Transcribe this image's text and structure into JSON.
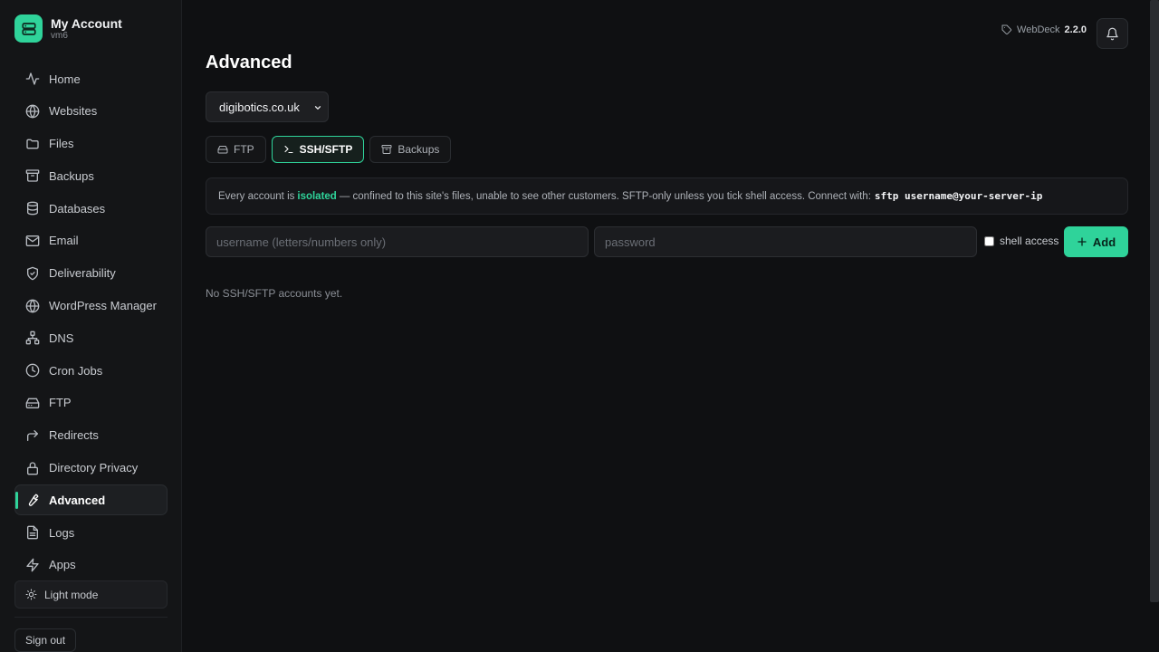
{
  "brand": {
    "title": "My Account",
    "subtitle": "vm6"
  },
  "sidebar": {
    "items": [
      {
        "label": "Home",
        "icon": "activity-icon"
      },
      {
        "label": "Websites",
        "icon": "globe-icon"
      },
      {
        "label": "Files",
        "icon": "folder-icon"
      },
      {
        "label": "Backups",
        "icon": "archive-icon"
      },
      {
        "label": "Databases",
        "icon": "database-icon"
      },
      {
        "label": "Email",
        "icon": "mail-icon"
      },
      {
        "label": "Deliverability",
        "icon": "shield-icon"
      },
      {
        "label": "WordPress Manager",
        "icon": "globe-icon"
      },
      {
        "label": "DNS",
        "icon": "network-icon"
      },
      {
        "label": "Cron Jobs",
        "icon": "clock-icon"
      },
      {
        "label": "FTP",
        "icon": "drive-icon"
      },
      {
        "label": "Redirects",
        "icon": "redirect-arrow-icon"
      },
      {
        "label": "Directory Privacy",
        "icon": "lock-icon"
      },
      {
        "label": "Advanced",
        "icon": "wrench-icon",
        "active": true
      },
      {
        "label": "Logs",
        "icon": "file-text-icon"
      },
      {
        "label": "Apps",
        "icon": "zap-icon"
      }
    ],
    "light_mode": "Light mode",
    "sign_out": "Sign out"
  },
  "header": {
    "product": "WebDeck",
    "version": "2.2.0"
  },
  "main": {
    "title": "Advanced",
    "domain": "digibotics.co.uk",
    "tabs": [
      {
        "label": "FTP",
        "icon": "drive-icon"
      },
      {
        "label": "SSH/SFTP",
        "icon": "terminal-icon",
        "active": true
      },
      {
        "label": "Backups",
        "icon": "archive-icon"
      }
    ],
    "info": {
      "prefix": "Every account is",
      "highlight": "isolated",
      "suffix": "— confined to this site's files, unable to see other customers. SFTP-only unless you tick shell access. Connect with:",
      "command": "sftp username@your-server-ip"
    },
    "form": {
      "username_placeholder": "username (letters/numbers only)",
      "password_placeholder": "password",
      "shell_label": "shell access",
      "add_label": "Add"
    },
    "empty": "No SSH/SFTP accounts yet."
  },
  "colors": {
    "accent": "#2fd39a",
    "background": "#0f1012",
    "sidebar": "#141517"
  }
}
